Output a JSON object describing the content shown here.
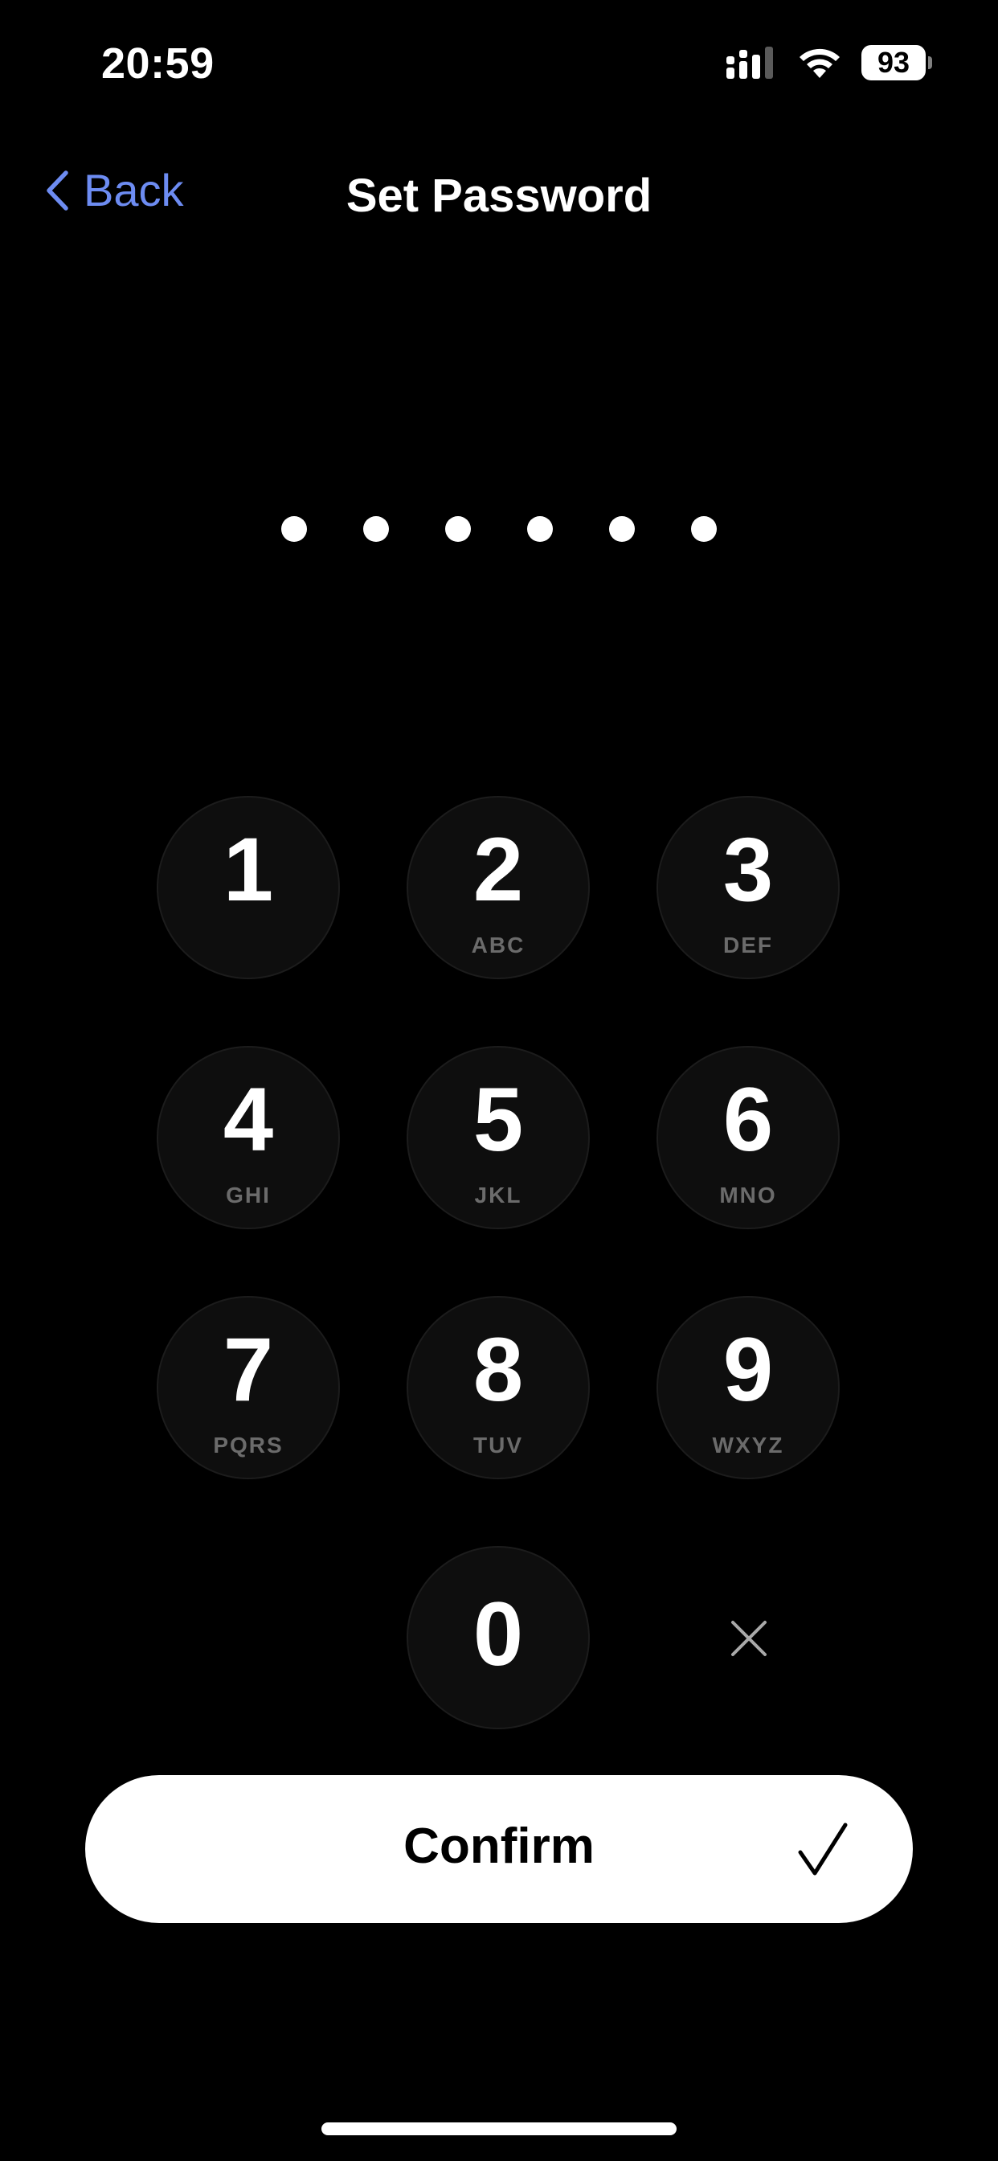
{
  "status_bar": {
    "time": "20:59",
    "battery_level": "93",
    "icons": [
      "cellular-signal-icon",
      "wifi-icon",
      "battery-icon"
    ]
  },
  "nav": {
    "back_label": "Back",
    "title": "Set Password"
  },
  "password": {
    "entered_count": 6
  },
  "keypad": {
    "keys": [
      {
        "digit": "1",
        "letters": ""
      },
      {
        "digit": "2",
        "letters": "ABC"
      },
      {
        "digit": "3",
        "letters": "DEF"
      },
      {
        "digit": "4",
        "letters": "GHI"
      },
      {
        "digit": "5",
        "letters": "JKL"
      },
      {
        "digit": "6",
        "letters": "MNO"
      },
      {
        "digit": "7",
        "letters": "PQRS"
      },
      {
        "digit": "8",
        "letters": "TUV"
      },
      {
        "digit": "9",
        "letters": "WXYZ"
      },
      {
        "digit": "0",
        "letters": ""
      }
    ],
    "delete_icon": "close-icon"
  },
  "confirm": {
    "label": "Confirm",
    "icon": "checkmark-icon"
  },
  "colors": {
    "background": "#000000",
    "accent": "#6d8cf2",
    "key_fill": "#0e0e0e",
    "confirm_bg": "#ffffff"
  }
}
